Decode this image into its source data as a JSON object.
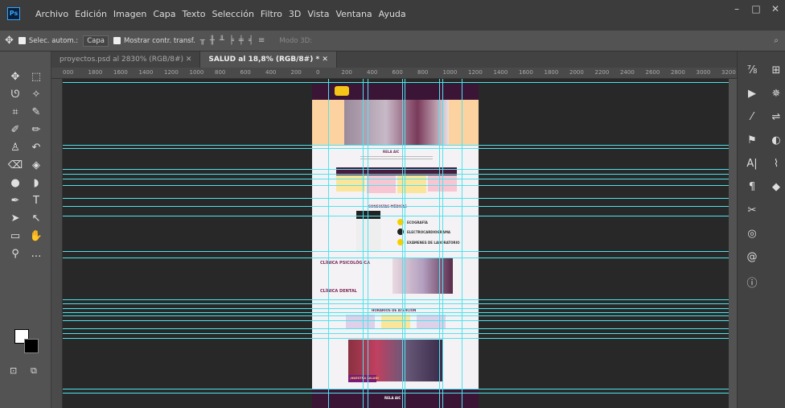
{
  "app": {
    "logo": "Ps"
  },
  "menu": [
    "Archivo",
    "Edición",
    "Imagen",
    "Capa",
    "Texto",
    "Selección",
    "Filtro",
    "3D",
    "Vista",
    "Ventana",
    "Ayuda"
  ],
  "options": {
    "auto_select": "Selec. autom.:",
    "target": "Capa",
    "show_transform": "Mostrar contr. transf.",
    "mode3d": "Modo 3D:"
  },
  "tabs": [
    {
      "label": "proyectos.psd al 2830% (RGB/8#)"
    },
    {
      "label": "SALUD al 18,8% (RGB/8#) *"
    }
  ],
  "ruler": [
    "000",
    "1800",
    "1600",
    "1400",
    "1200",
    "1000",
    "800",
    "600",
    "400",
    "200",
    "0",
    "200",
    "400",
    "600",
    "800",
    "1000",
    "1200",
    "1400",
    "1600",
    "1800",
    "2000",
    "2200",
    "2400",
    "2600",
    "2800",
    "3000",
    "3200"
  ],
  "document": {
    "sections": {
      "about": "RELA AIC",
      "consult": "CONSULTAS MÉDICAS",
      "psych": "CLÍNICA PSICOLÓGICA",
      "dental": "CLÍNICA DENTAL",
      "schedule": "HORARIOS DE ATENCIÓN",
      "footer": "RELA AIC"
    },
    "services": [
      "ECOGRAFÍA",
      "ELECTROCARDIOGRAMA",
      "EXÁMENES DE LABORATORIO"
    ],
    "cards": [
      "CONTROL NIÑO SANO",
      "PLANIFICACIÓN FAMILIAR",
      "VACUNACIÓN"
    ],
    "badge": "¡NUESTRA SALUD!"
  }
}
